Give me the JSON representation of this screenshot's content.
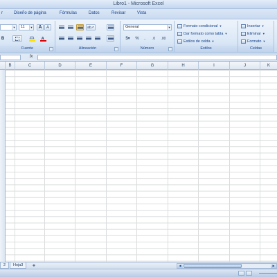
{
  "window": {
    "title": "Libro1 - Microsoft Excel"
  },
  "tabs": [
    {
      "label": "r"
    },
    {
      "label": "Diseño de página"
    },
    {
      "label": "Fórmulas"
    },
    {
      "label": "Datos"
    },
    {
      "label": "Revisar"
    },
    {
      "label": "Vista"
    }
  ],
  "ribbon": {
    "font_group": {
      "label": "Fuente",
      "font_size": "11"
    },
    "alignment_group": {
      "label": "Alineación"
    },
    "number_group": {
      "label": "Número",
      "format": "General"
    },
    "styles_group": {
      "label": "Estilos",
      "conditional_format": "Formato condicional",
      "format_as_table": "Dar formato como tabla",
      "cell_styles": "Estilos de celda"
    },
    "cells_group": {
      "label": "Celdas",
      "insert": "Insertar",
      "delete": "Eliminar",
      "format": "Formato"
    }
  },
  "formula_bar": {
    "fx_label": "fx"
  },
  "columns": [
    "B",
    "C",
    "D",
    "E",
    "F",
    "G",
    "H",
    "I",
    "J",
    "K"
  ],
  "sheets": [
    {
      "label": "2"
    },
    {
      "label": "Hoja3"
    }
  ],
  "colors": {
    "accent": "#15428b",
    "ribbon_top": "#eef4fb",
    "ribbon_bottom": "#c9dbef",
    "active_button": "#f7c55a"
  },
  "icons": {
    "insert_sheet": "insert-sheet-icon",
    "bold": "bold-icon",
    "fill_color": "fill-color-icon",
    "font_color": "font-color-icon"
  }
}
